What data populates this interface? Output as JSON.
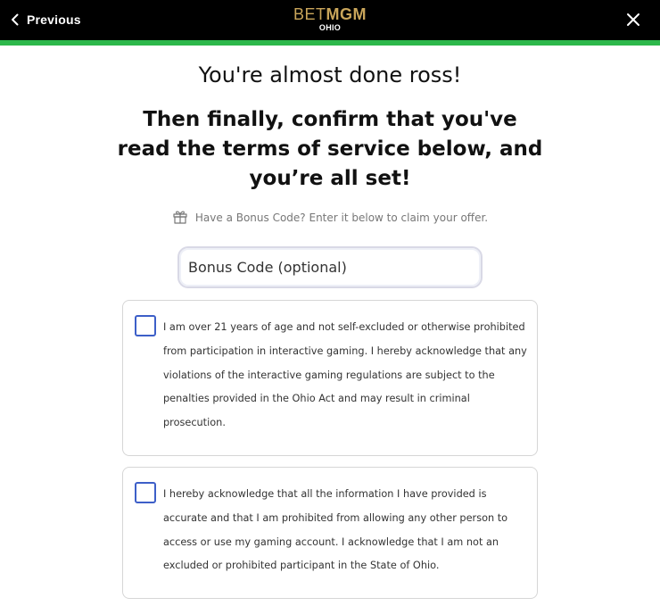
{
  "header": {
    "previous_label": "Previous",
    "logo_bet": "BET",
    "logo_mgm": "MGM",
    "logo_state": "OHIO",
    "brand_color": "#c9a55a",
    "accent_green": "#2db84b"
  },
  "main": {
    "greeting": "You're almost done ross!",
    "headline": "Then finally, confirm that you've read the terms of service below, and you’re all set!",
    "bonus_hint": "Have a Bonus Code? Enter it below to claim your offer.",
    "bonus_placeholder": "Bonus Code (optional)",
    "bonus_value": ""
  },
  "terms": [
    {
      "text": "I am over 21 years of age and not self-excluded or otherwise prohibited from participation in interactive gaming. I hereby acknowledge that any violations of the interactive gaming regulations are subject to the penalties provided in the Ohio Act and may result in criminal prosecution.",
      "checked": false
    },
    {
      "text": "I hereby acknowledge that all the information I have provided is accurate and that I am prohibited from allowing any other person to access or use my gaming account. I acknowledge that I am not an excluded or prohibited participant in the State of Ohio.",
      "checked": false
    }
  ],
  "icons": {
    "back": "chevron-left-icon",
    "close": "close-icon",
    "gift": "gift-icon"
  }
}
